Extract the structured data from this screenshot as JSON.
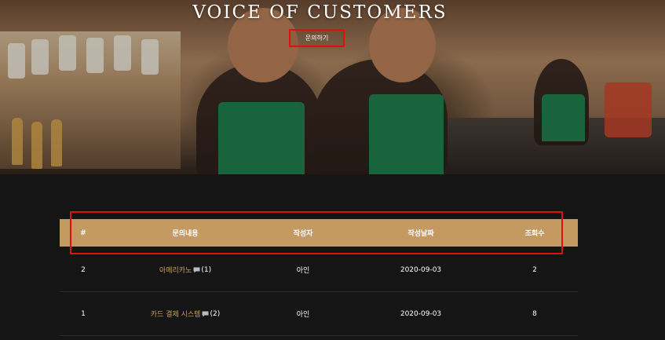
{
  "hero": {
    "title": "VOICE OF CUSTOMERS",
    "inquiry_button": "문의하기"
  },
  "table": {
    "headers": {
      "num": "#",
      "title": "문의내용",
      "author": "작성자",
      "date": "작성날짜",
      "views": "조회수"
    },
    "rows": [
      {
        "num": "2",
        "title": "아메리카노",
        "comments": "(1)",
        "author": "아인",
        "date": "2020-09-03",
        "views": "2"
      },
      {
        "num": "1",
        "title": "카드 결제 시스템",
        "comments": "(2)",
        "author": "아인",
        "date": "2020-09-03",
        "views": "8"
      }
    ]
  },
  "colors": {
    "accent": "#c49a62",
    "link": "#c9a063",
    "highlight": "#e01010",
    "background": "#151515"
  }
}
